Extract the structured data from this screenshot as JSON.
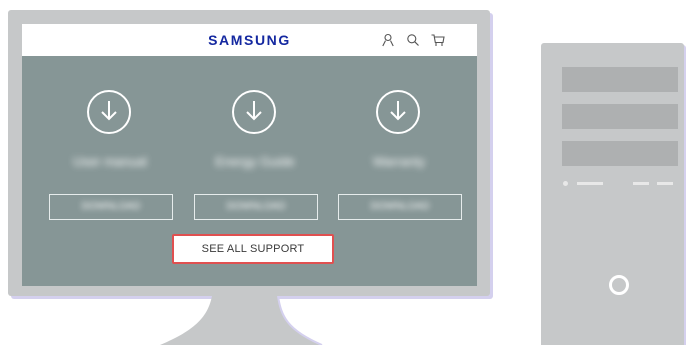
{
  "topbar": {
    "brand": "SAMSUNG",
    "icons": [
      "user-icon",
      "search-icon",
      "cart-icon"
    ]
  },
  "support_columns": [
    {
      "title": "User manual",
      "button_label": "DOWNLOAD",
      "icon": "download-icon"
    },
    {
      "title": "Energy Guide",
      "button_label": "DOWNLOAD",
      "icon": "download-icon"
    },
    {
      "title": "Warranty",
      "button_label": "DOWNLOAD",
      "icon": "download-icon"
    }
  ],
  "see_all_support": {
    "label": "SEE ALL SUPPORT"
  },
  "colors": {
    "brand": "#1428a0",
    "screen_background": "#869696",
    "highlight_border": "#e05050",
    "device_body": "#c6c8c9"
  }
}
